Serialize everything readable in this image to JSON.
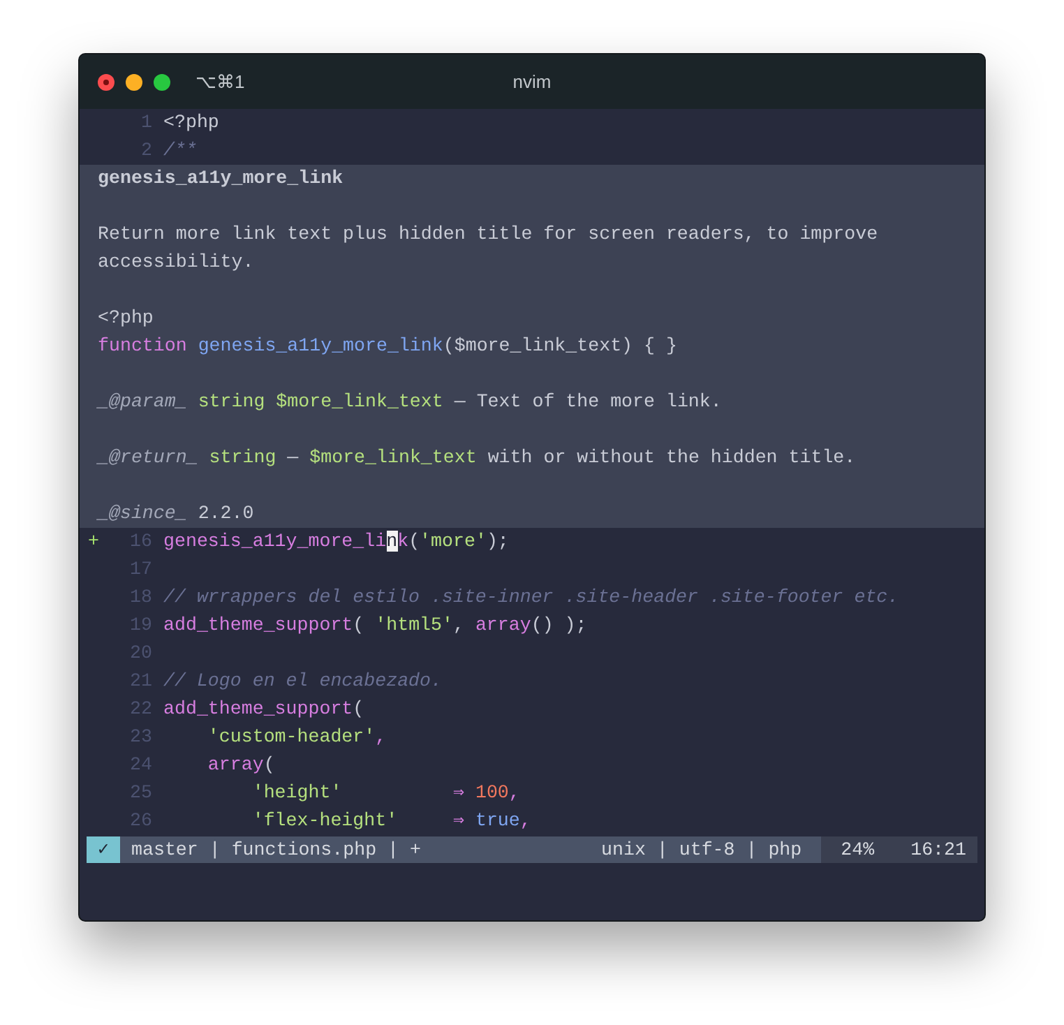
{
  "window": {
    "title": "nvim",
    "shortcut": "⌥⌘1"
  },
  "editor": {
    "lines_before": [
      {
        "number": "1",
        "tokens": [
          {
            "kind": "plain",
            "text": "<?php"
          }
        ]
      },
      {
        "number": "2",
        "tokens": [
          {
            "kind": "comment",
            "text": "/**"
          }
        ]
      }
    ],
    "popup": {
      "blocks": [
        {
          "kind": "title",
          "lines": [
            [
              {
                "kind": "plain",
                "text": "genesis_a11y_more_link"
              }
            ]
          ]
        },
        {
          "kind": "text",
          "lines": [
            [
              {
                "kind": "plain",
                "text": "Return more link text plus hidden title for screen readers, to improve accessibility."
              }
            ]
          ]
        },
        {
          "kind": "code",
          "lines": [
            [
              {
                "kind": "plain",
                "text": "<?php"
              }
            ],
            [
              {
                "kind": "keyword",
                "text": "function "
              },
              {
                "kind": "name",
                "text": "genesis_a11y_more_link"
              },
              {
                "kind": "plain",
                "text": "($more_link_text) { }"
              }
            ]
          ]
        },
        {
          "kind": "text",
          "lines": [
            [
              {
                "kind": "tag",
                "text": "_@param_"
              },
              {
                "kind": "string",
                "text": " string $more_link_text"
              },
              {
                "kind": "plain",
                "text": " — Text of the more link."
              }
            ]
          ]
        },
        {
          "kind": "text",
          "lines": [
            [
              {
                "kind": "tag",
                "text": "_@return_"
              },
              {
                "kind": "string",
                "text": " string"
              },
              {
                "kind": "plain",
                "text": " — "
              },
              {
                "kind": "string",
                "text": "$more_link_text"
              },
              {
                "kind": "plain",
                "text": " with or without the hidden title."
              }
            ]
          ]
        },
        {
          "kind": "text",
          "lines": [
            [
              {
                "kind": "tag",
                "text": "_@since_"
              },
              {
                "kind": "plain",
                "text": " 2.2.0"
              }
            ]
          ]
        }
      ]
    },
    "lines_after": [
      {
        "number": "16",
        "sign": "+",
        "tokens": [
          {
            "kind": "call",
            "text": "genesis_a11y_more_li"
          },
          {
            "kind": "cursor",
            "text": "n"
          },
          {
            "kind": "call",
            "text": "k"
          },
          {
            "kind": "plain",
            "text": "("
          },
          {
            "kind": "string",
            "text": "'more'"
          },
          {
            "kind": "plain",
            "text": ");"
          }
        ]
      },
      {
        "number": "17"
      },
      {
        "number": "18",
        "tokens": [
          {
            "kind": "comment",
            "text": "// wrrappers del estilo .site-inner .site-header .site-footer etc."
          }
        ]
      },
      {
        "number": "19",
        "tokens": [
          {
            "kind": "call",
            "text": "add_theme_support"
          },
          {
            "kind": "plain",
            "text": "( "
          },
          {
            "kind": "string",
            "text": "'html5'"
          },
          {
            "kind": "plain",
            "text": ", "
          },
          {
            "kind": "call",
            "text": "array"
          },
          {
            "kind": "plain",
            "text": "() );"
          }
        ]
      },
      {
        "number": "20"
      },
      {
        "number": "21",
        "tokens": [
          {
            "kind": "comment",
            "text": "// Logo en el encabezado."
          }
        ]
      },
      {
        "number": "22",
        "tokens": [
          {
            "kind": "call",
            "text": "add_theme_support"
          },
          {
            "kind": "plain",
            "text": "("
          }
        ]
      },
      {
        "number": "23",
        "tokens": [
          {
            "kind": "string",
            "text": "    'custom-header'"
          },
          {
            "kind": "call",
            "text": ","
          }
        ]
      },
      {
        "number": "24",
        "tokens": [
          {
            "kind": "call",
            "text": "    array"
          },
          {
            "kind": "plain",
            "text": "("
          }
        ]
      },
      {
        "number": "25",
        "tokens": [
          {
            "kind": "string",
            "text": "        'height'          "
          },
          {
            "kind": "call",
            "text": "⇒ "
          },
          {
            "kind": "number",
            "text": "100"
          },
          {
            "kind": "call",
            "text": ","
          }
        ]
      },
      {
        "number": "26",
        "tokens": [
          {
            "kind": "string",
            "text": "        'flex-height'     "
          },
          {
            "kind": "call",
            "text": "⇒ "
          },
          {
            "kind": "name",
            "text": "true"
          },
          {
            "kind": "call",
            "text": ","
          }
        ]
      }
    ]
  },
  "status_bar": {
    "check": "✓",
    "left": "master | functions.php | +",
    "right": "unix | utf-8 | php",
    "percent": "24%",
    "position": "16:21"
  }
}
